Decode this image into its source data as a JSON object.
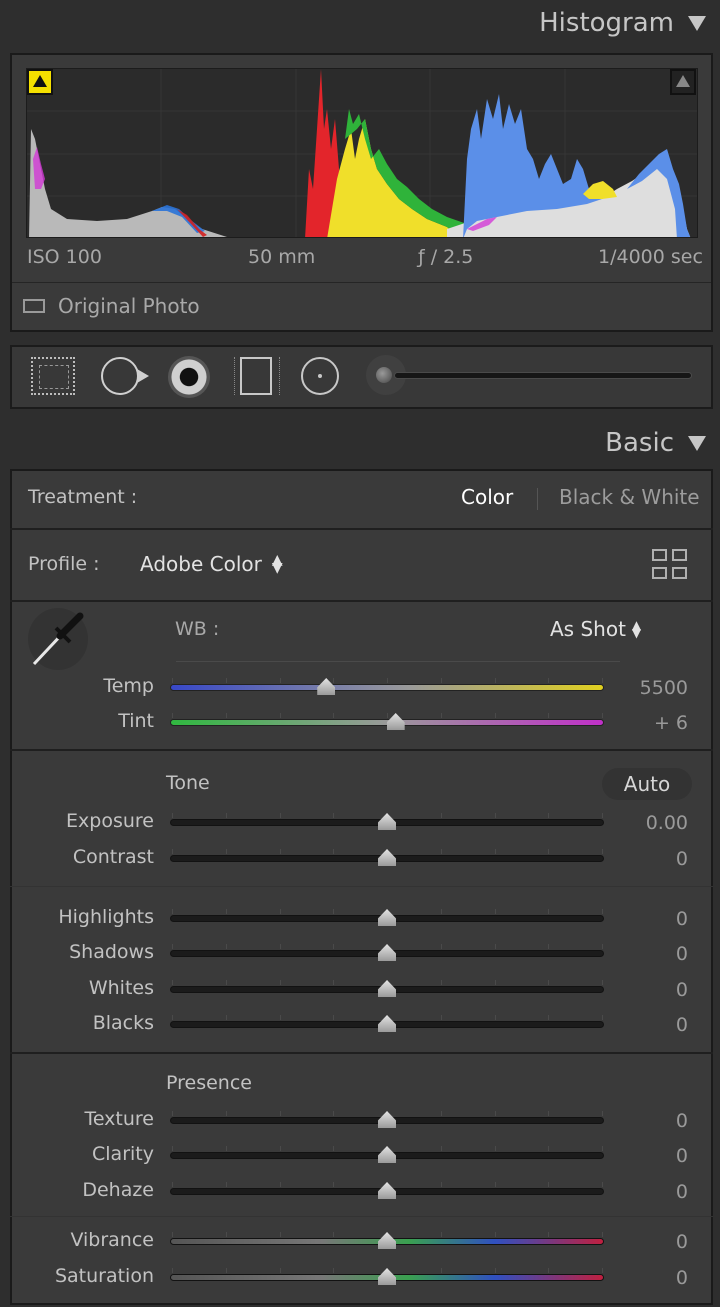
{
  "histogram": {
    "title": "Histogram",
    "exif": {
      "iso": "ISO 100",
      "focal": "50 mm",
      "aperture": "ƒ / 2.5",
      "shutter": "1/4000 sec"
    },
    "original_photo_label": "Original Photo"
  },
  "basic": {
    "title": "Basic",
    "treatment_label": "Treatment :",
    "treatment_options": [
      "Color",
      "Black & White"
    ],
    "profile_label": "Profile :",
    "profile_value": "Adobe Color",
    "wb_label": "WB :",
    "wb_value": "As Shot",
    "temp": {
      "label": "Temp",
      "value": "5500",
      "position": 0.36
    },
    "tint": {
      "label": "Tint",
      "value": "+ 6",
      "position": 0.52
    },
    "tone_label": "Tone",
    "auto_label": "Auto",
    "exposure": {
      "label": "Exposure",
      "value": "0.00",
      "position": 0.5
    },
    "contrast": {
      "label": "Contrast",
      "value": "0",
      "position": 0.5
    },
    "highlights": {
      "label": "Highlights",
      "value": "0",
      "position": 0.5
    },
    "shadows": {
      "label": "Shadows",
      "value": "0",
      "position": 0.5
    },
    "whites": {
      "label": "Whites",
      "value": "0",
      "position": 0.5
    },
    "blacks": {
      "label": "Blacks",
      "value": "0",
      "position": 0.5
    },
    "presence_label": "Presence",
    "texture": {
      "label": "Texture",
      "value": "0",
      "position": 0.5
    },
    "clarity": {
      "label": "Clarity",
      "value": "0",
      "position": 0.5
    },
    "dehaze": {
      "label": "Dehaze",
      "value": "0",
      "position": 0.5
    },
    "vibrance": {
      "label": "Vibrance",
      "value": "0",
      "position": 0.5
    },
    "saturation": {
      "label": "Saturation",
      "value": "0",
      "position": 0.5
    }
  },
  "colors": {
    "panel_bg": "#2e2e2e",
    "box_bg": "#3a3a3a",
    "text": "#c8c8c8",
    "highlight_text": "#ffffff",
    "clip_warning": "#f5e000"
  }
}
